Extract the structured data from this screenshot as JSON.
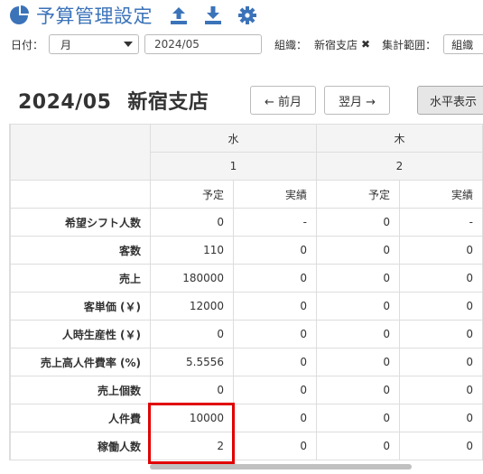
{
  "header": {
    "title": "予算管理設定",
    "icons": [
      "pie-chart-icon",
      "upload-icon",
      "download-icon",
      "gear-icon"
    ]
  },
  "filters": {
    "date_label": "日付：",
    "period_value": "月",
    "date_value": "2024/05",
    "org_label": "組織：",
    "org_value": "新宿支店",
    "agg_label": "集計範囲：",
    "agg_value": "組織"
  },
  "view": {
    "period": "2024/05",
    "store": "新宿支店",
    "prev_label": "← 前月",
    "next_label": "翌月 →",
    "horizontal_label": "水平表示"
  },
  "grid": {
    "days": [
      {
        "weekday": "水",
        "date": "1",
        "plan_label": "予定",
        "actual_label": "実績"
      },
      {
        "weekday": "木",
        "date": "2",
        "plan_label": "予定",
        "actual_label": "実績"
      }
    ],
    "rows": [
      {
        "label": "希望シフト人数",
        "values": [
          "0",
          "-",
          "0",
          "-"
        ]
      },
      {
        "label": "客数",
        "values": [
          "110",
          "0",
          "0",
          "0"
        ]
      },
      {
        "label": "売上",
        "values": [
          "180000",
          "0",
          "0",
          "0"
        ]
      },
      {
        "label": "客単価 (￥)",
        "values": [
          "12000",
          "0",
          "0",
          "0"
        ]
      },
      {
        "label": "人時生産性 (￥)",
        "values": [
          "0",
          "0",
          "0",
          "0"
        ]
      },
      {
        "label": "売上高人件費率 (%)",
        "values": [
          "5.5556",
          "0",
          "0",
          "0"
        ]
      },
      {
        "label": "売上個数",
        "values": [
          "0",
          "0",
          "0",
          "0"
        ]
      },
      {
        "label": "人件費",
        "values": [
          "10000",
          "0",
          "0",
          "0"
        ]
      },
      {
        "label": "稼働人数",
        "values": [
          "2",
          "0",
          "0",
          "0"
        ]
      }
    ]
  },
  "colors": {
    "accent": "#3b73b9",
    "highlight": "#e00000"
  }
}
